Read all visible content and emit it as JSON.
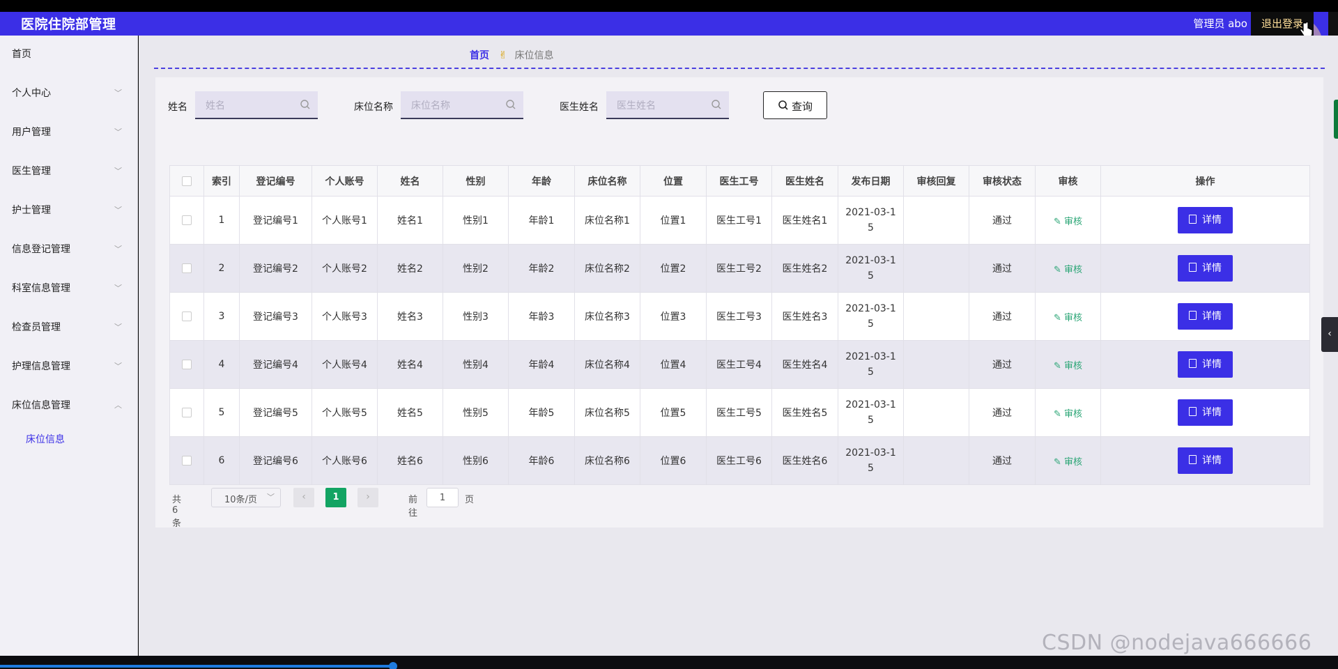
{
  "header": {
    "app_title": "医院住院部管理",
    "user_label": "管理员 abo",
    "logout_label": "退出登录"
  },
  "sidebar": {
    "items": [
      {
        "label": "首页",
        "has_chevron": false
      },
      {
        "label": "个人中心",
        "has_chevron": true
      },
      {
        "label": "用户管理",
        "has_chevron": true
      },
      {
        "label": "医生管理",
        "has_chevron": true
      },
      {
        "label": "护士管理",
        "has_chevron": true
      },
      {
        "label": "信息登记管理",
        "has_chevron": true
      },
      {
        "label": "科室信息管理",
        "has_chevron": true
      },
      {
        "label": "检查员管理",
        "has_chevron": true
      },
      {
        "label": "护理信息管理",
        "has_chevron": true
      },
      {
        "label": "床位信息管理",
        "has_chevron": true,
        "expanded": true
      }
    ],
    "sub_item": "床位信息"
  },
  "breadcrumb": {
    "home": "首页",
    "current": "床位信息"
  },
  "search": {
    "name_label": "姓名",
    "name_placeholder": "姓名",
    "bed_label": "床位名称",
    "bed_placeholder": "床位名称",
    "doctor_label": "医生姓名",
    "doctor_placeholder": "医生姓名",
    "query_label": "查询"
  },
  "table": {
    "headers": [
      "索引",
      "登记编号",
      "个人账号",
      "姓名",
      "性别",
      "年龄",
      "床位名称",
      "位置",
      "医生工号",
      "医生姓名",
      "发布日期",
      "审核回复",
      "审核状态",
      "审核",
      "操作"
    ],
    "rows": [
      {
        "index": "1",
        "reg_no": "登记编号1",
        "account": "个人账号1",
        "name": "姓名1",
        "gender": "性别1",
        "age": "年龄1",
        "bed": "床位名称1",
        "position": "位置1",
        "doc_id": "医生工号1",
        "doc_name": "医生姓名1",
        "date_a": "2021-03-1",
        "date_b": "5",
        "reply": "",
        "status": "通过",
        "audit": "审核",
        "action": "详情"
      },
      {
        "index": "2",
        "reg_no": "登记编号2",
        "account": "个人账号2",
        "name": "姓名2",
        "gender": "性别2",
        "age": "年龄2",
        "bed": "床位名称2",
        "position": "位置2",
        "doc_id": "医生工号2",
        "doc_name": "医生姓名2",
        "date_a": "2021-03-1",
        "date_b": "5",
        "reply": "",
        "status": "通过",
        "audit": "审核",
        "action": "详情"
      },
      {
        "index": "3",
        "reg_no": "登记编号3",
        "account": "个人账号3",
        "name": "姓名3",
        "gender": "性别3",
        "age": "年龄3",
        "bed": "床位名称3",
        "position": "位置3",
        "doc_id": "医生工号3",
        "doc_name": "医生姓名3",
        "date_a": "2021-03-1",
        "date_b": "5",
        "reply": "",
        "status": "通过",
        "audit": "审核",
        "action": "详情"
      },
      {
        "index": "4",
        "reg_no": "登记编号4",
        "account": "个人账号4",
        "name": "姓名4",
        "gender": "性别4",
        "age": "年龄4",
        "bed": "床位名称4",
        "position": "位置4",
        "doc_id": "医生工号4",
        "doc_name": "医生姓名4",
        "date_a": "2021-03-1",
        "date_b": "5",
        "reply": "",
        "status": "通过",
        "audit": "审核",
        "action": "详情"
      },
      {
        "index": "5",
        "reg_no": "登记编号5",
        "account": "个人账号5",
        "name": "姓名5",
        "gender": "性别5",
        "age": "年龄5",
        "bed": "床位名称5",
        "position": "位置5",
        "doc_id": "医生工号5",
        "doc_name": "医生姓名5",
        "date_a": "2021-03-1",
        "date_b": "5",
        "reply": "",
        "status": "通过",
        "audit": "审核",
        "action": "详情"
      },
      {
        "index": "6",
        "reg_no": "登记编号6",
        "account": "个人账号6",
        "name": "姓名6",
        "gender": "性别6",
        "age": "年龄6",
        "bed": "床位名称6",
        "position": "位置6",
        "doc_id": "医生工号6",
        "doc_name": "医生姓名6",
        "date_a": "2021-03-1",
        "date_b": "5",
        "reply": "",
        "status": "通过",
        "audit": "审核",
        "action": "详情"
      }
    ]
  },
  "pagination": {
    "total": "共 6 条",
    "page_size": "10条/页",
    "current_page": "1",
    "goto_prefix": "前往",
    "goto_value": "1",
    "goto_suffix": "页"
  },
  "watermark": "CSDN @nodejava666666",
  "colors": {
    "primary": "#3b2fe6",
    "success": "#13a463",
    "audit_link": "#2aa575"
  },
  "icons": {
    "search": "magnifier-icon",
    "breadcrumb_sep": "hand-icon",
    "audit": "pen-icon",
    "detail": "document-icon"
  }
}
